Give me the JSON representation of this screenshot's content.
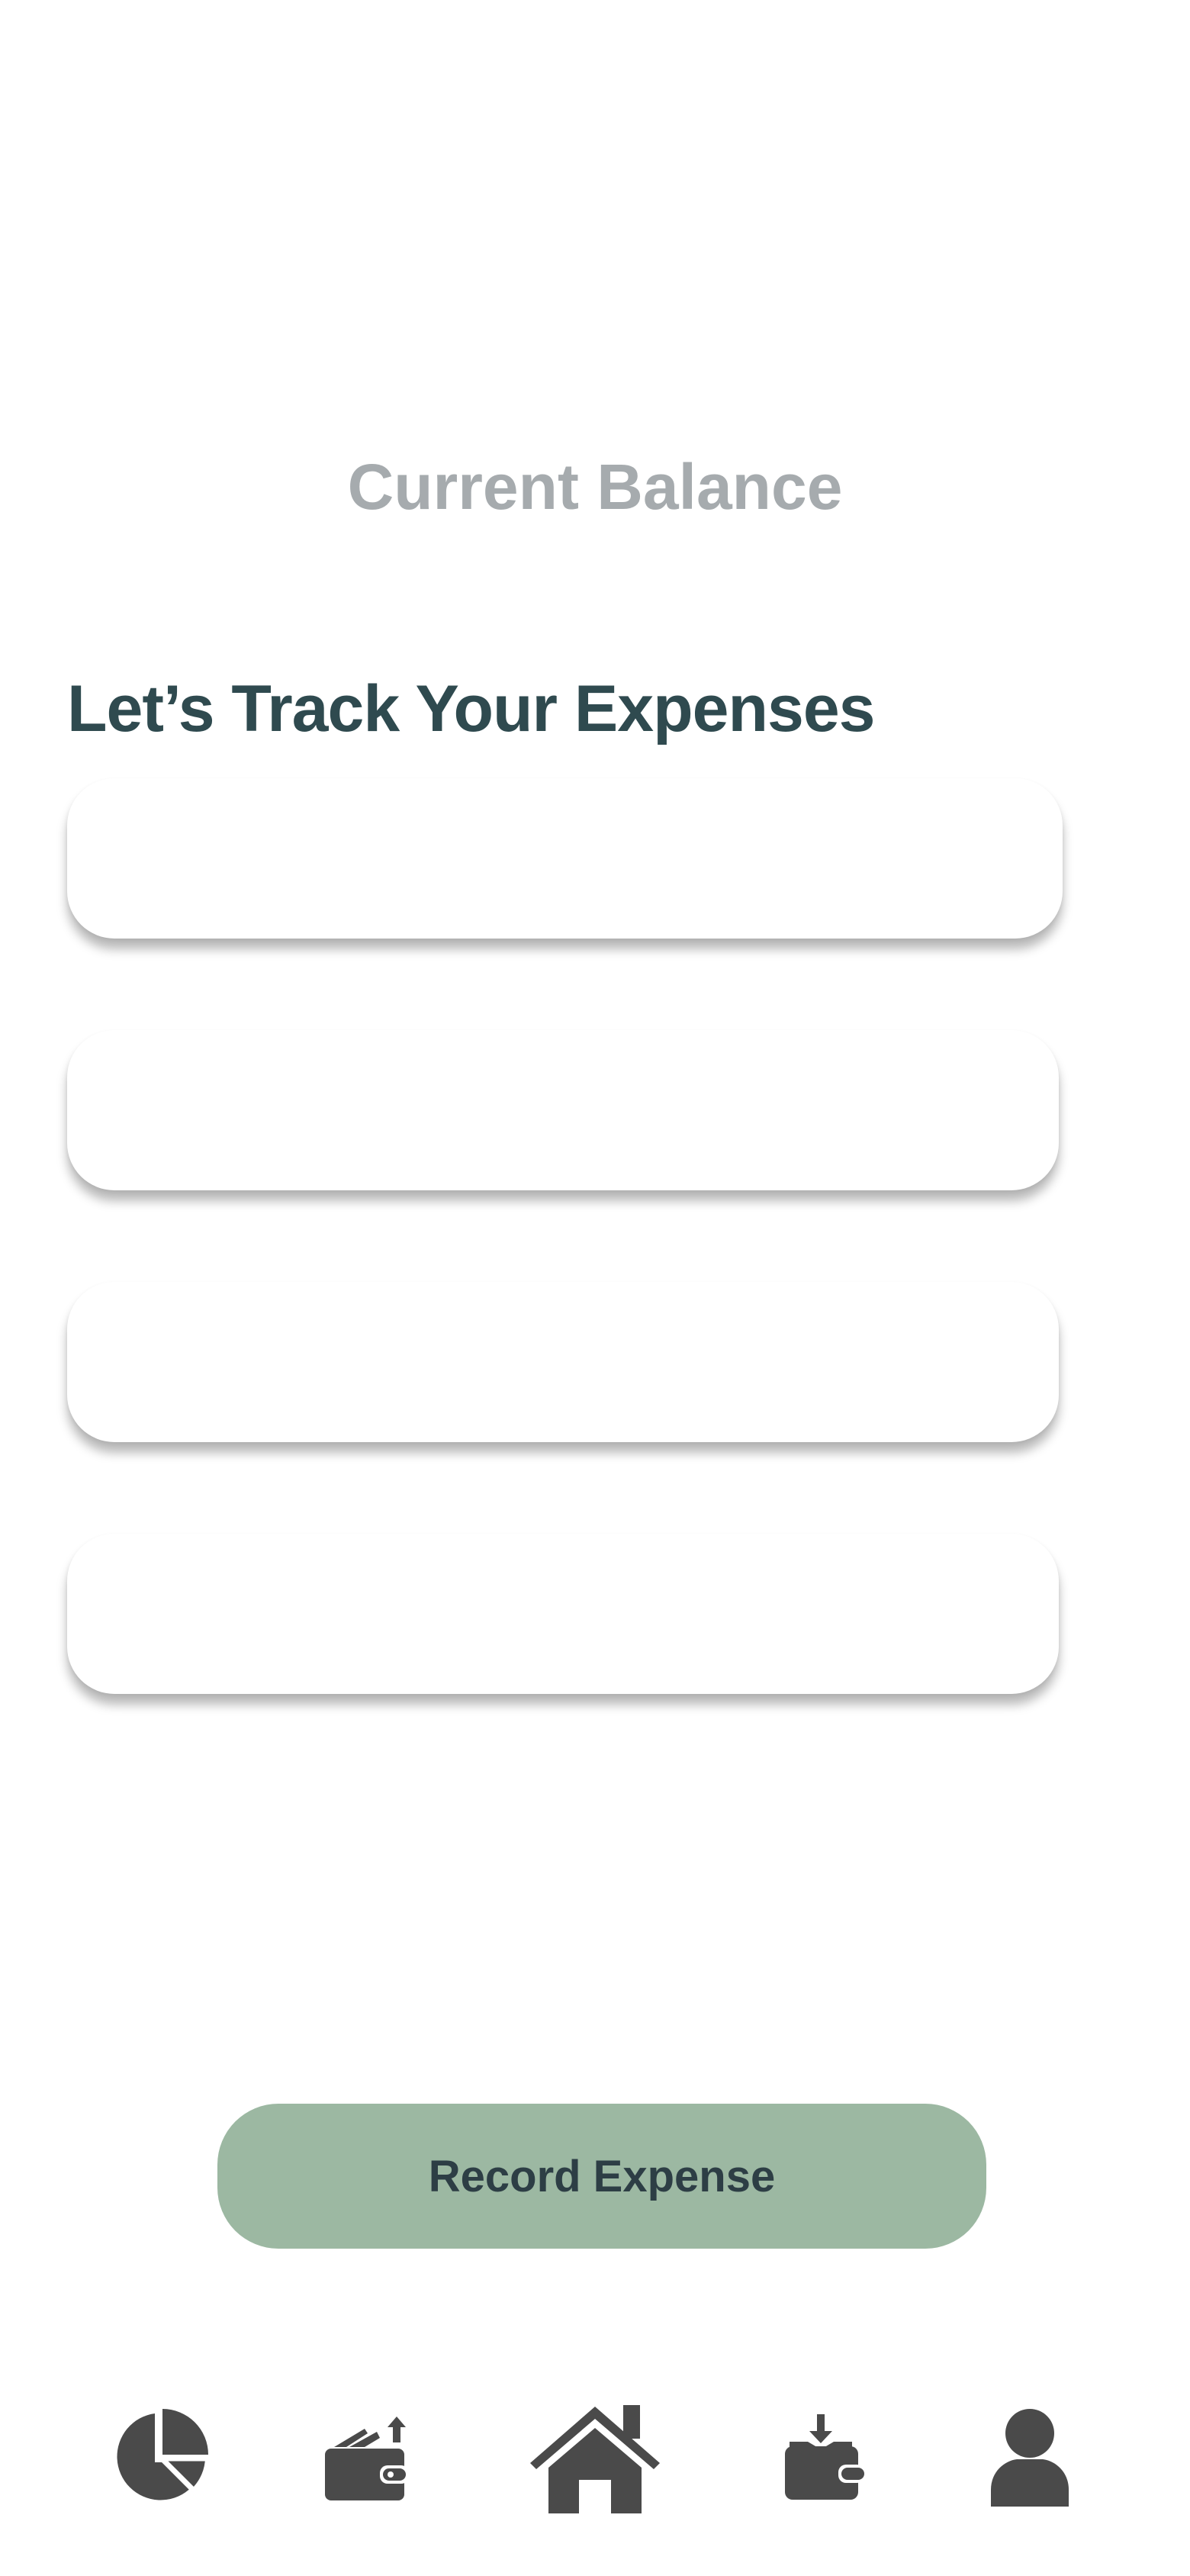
{
  "balance": {
    "label": "Current Balance"
  },
  "expenses_section": {
    "heading": "Let’s Track Your Expenses",
    "cards": [
      {
        "content": ""
      },
      {
        "content": ""
      },
      {
        "content": ""
      },
      {
        "content": ""
      }
    ]
  },
  "actions": {
    "record_label": "Record Expense",
    "record_color": "#9cb8a2"
  },
  "bottom_nav": {
    "icon_color": "#4a4a4a",
    "items": [
      {
        "name": "stats",
        "icon": "pie-chart-icon"
      },
      {
        "name": "expense",
        "icon": "wallet-out-icon"
      },
      {
        "name": "home",
        "icon": "home-icon",
        "active": true
      },
      {
        "name": "income",
        "icon": "wallet-in-icon"
      },
      {
        "name": "profile",
        "icon": "user-icon"
      }
    ]
  },
  "colors": {
    "heading": "#2f4a4f",
    "balance_label": "#a6abae",
    "button_text": "#2d3e45"
  }
}
